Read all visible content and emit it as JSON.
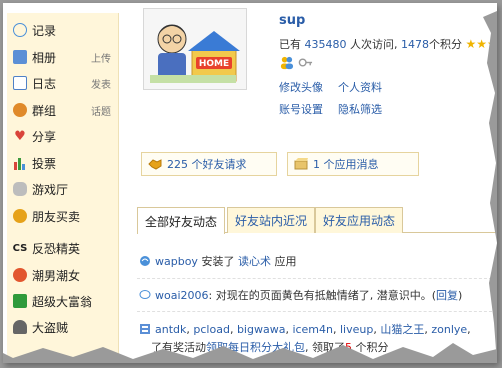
{
  "sidebar": {
    "items": [
      {
        "label": "记录",
        "sub": "",
        "icon": "speech-bubble-icon",
        "color": "#4a90d9"
      },
      {
        "label": "相册",
        "sub": "上传",
        "icon": "photo-album-icon",
        "color": "#5b8fd6"
      },
      {
        "label": "日志",
        "sub": "发表",
        "icon": "journal-icon",
        "color": "#4f81c7"
      },
      {
        "label": "群组",
        "sub": "话题",
        "icon": "group-icon",
        "color": "#e08a2a"
      },
      {
        "label": "分享",
        "sub": "",
        "icon": "share-heart-icon",
        "color": "#d9443a"
      },
      {
        "label": "投票",
        "sub": "",
        "icon": "vote-chart-icon",
        "color": "#3d9a3d"
      },
      {
        "label": "游戏厅",
        "sub": "",
        "icon": "gamepad-icon",
        "color": "#9a9a9a"
      },
      {
        "label": "朋友买卖",
        "sub": "",
        "icon": "coins-icon",
        "color": "#e6a21a"
      },
      {
        "label": "反恐精英",
        "sub": "",
        "icon": "cs-logo-icon",
        "color": "#222222"
      },
      {
        "label": "潮男潮女",
        "sub": "",
        "icon": "fashion-icon",
        "color": "#e2562e"
      },
      {
        "label": "超级大富翁",
        "sub": "",
        "icon": "tycoon-icon",
        "color": "#2f9a3a"
      },
      {
        "label": "大盗贼",
        "sub": "",
        "icon": "thief-icon",
        "color": "#444444"
      }
    ]
  },
  "profile": {
    "username": "sup",
    "stats_prefix": "已有",
    "visits": "435480",
    "visits_suffix": "人次访问,",
    "points": "1478",
    "points_suffix": "个积分",
    "avatar_sign": "HOME",
    "links": {
      "edit_avatar": "修改头像",
      "profile_info": "个人资料",
      "account_settings": "账号设置",
      "privacy_filter": "隐私筛选"
    }
  },
  "requests": {
    "friend_requests": "225 个好友请求",
    "app_messages": "1 个应用消息"
  },
  "tabs": [
    {
      "label": "全部好友动态",
      "active": true
    },
    {
      "label": "好友站内近况",
      "active": false
    },
    {
      "label": "好友应用动态",
      "active": false
    }
  ],
  "feed": {
    "item1": {
      "user": "wapboy",
      "action": "安装了",
      "app": "读心术",
      "suffix": "应用"
    },
    "item2": {
      "user": "woai2006",
      "text": ": 对现在的页面黄色有抵触情绪了, 潜意识中。(",
      "reply": "回复",
      "close": ")"
    },
    "item3": {
      "users": [
        "antdk",
        "pcload",
        "bigwawa",
        "icem4n",
        "liveup",
        "山猫之王",
        "zonlye"
      ],
      "line2_prefix": "了有奖活动",
      "line2_link": "领取每日积分大礼包",
      "line2_mid": ", 领取了",
      "line2_num": "5",
      "line2_end": "个积分"
    }
  }
}
